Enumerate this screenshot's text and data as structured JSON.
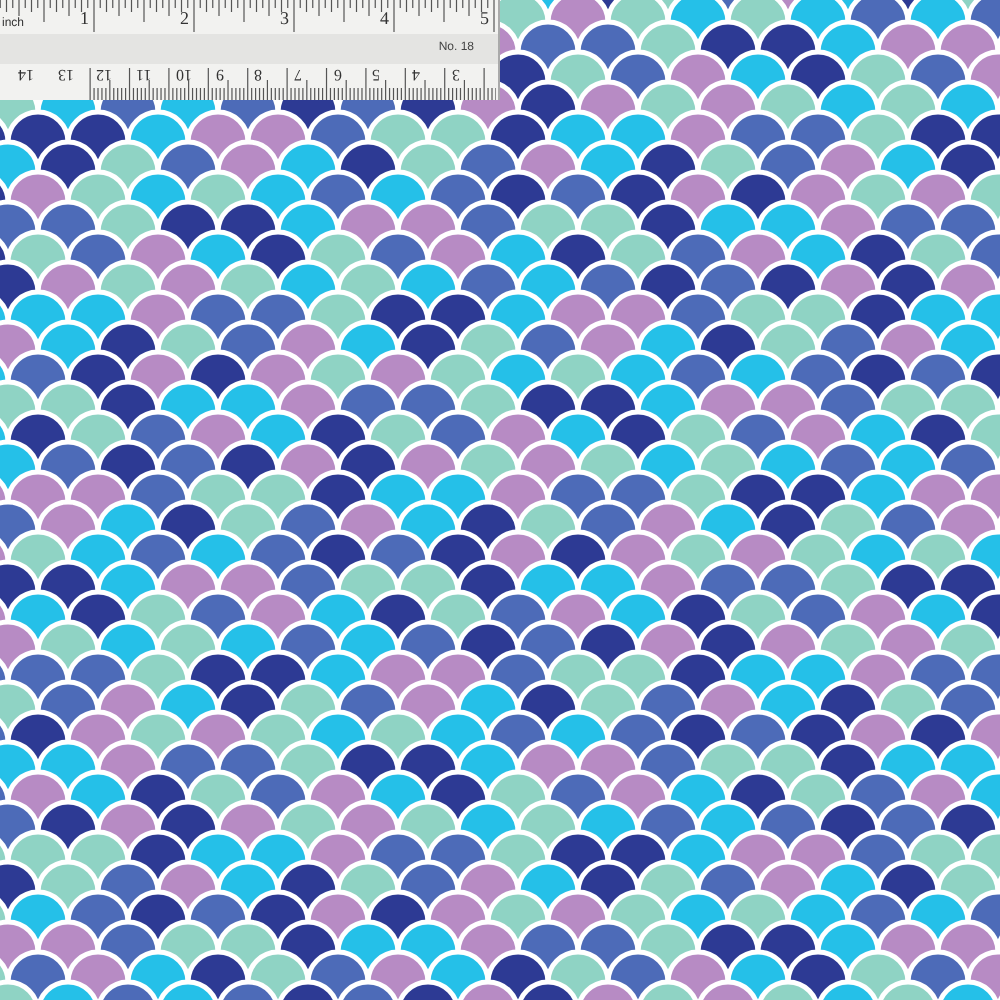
{
  "ruler": {
    "unit_label": "inch",
    "inch_numbers": [
      "1",
      "2",
      "3",
      "4",
      "5"
    ],
    "model": "No. 18",
    "cm_numbers": [
      "14",
      "13",
      "12",
      "11",
      "10",
      "9",
      "8",
      "7",
      "6",
      "5",
      "4",
      "3"
    ]
  }
}
